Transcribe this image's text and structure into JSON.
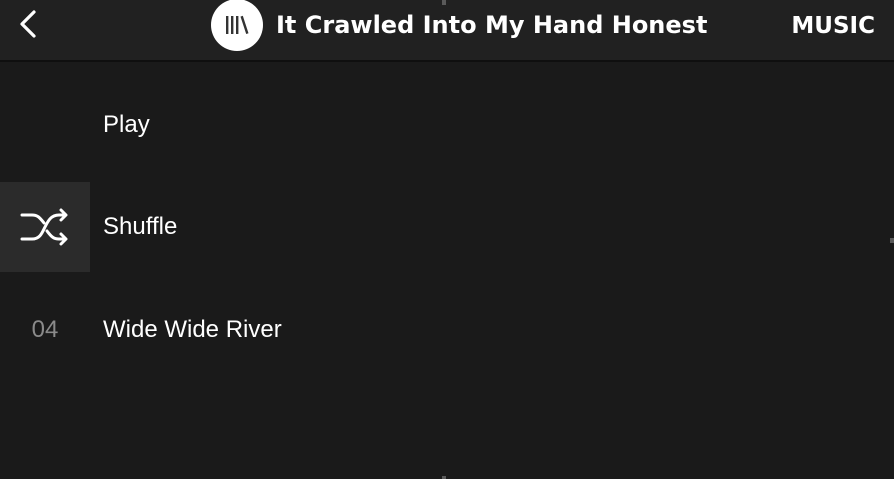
{
  "header": {
    "back_icon": "chevron-left-icon",
    "album_icon": "library-icon",
    "title": "It Crawled Into My Hand Honest",
    "section": "MUSIC"
  },
  "menu": {
    "items": [
      {
        "label": "Play",
        "icon": null,
        "selected": false
      },
      {
        "label": "Shuffle",
        "icon": "shuffle-icon",
        "selected": true
      },
      {
        "label": "Wide Wide River",
        "track_number": "04",
        "selected": false
      }
    ]
  },
  "colors": {
    "background": "#1a1a1a",
    "header_background": "#212121",
    "selected_background": "#2b2b2b",
    "text": "#ffffff",
    "muted_text": "#8a8a8a"
  }
}
